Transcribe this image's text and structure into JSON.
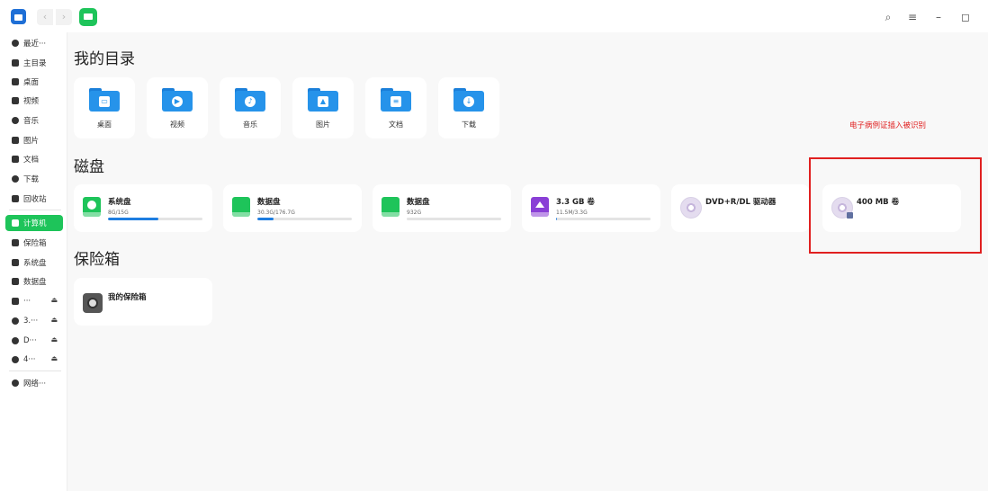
{
  "sidebar": {
    "items": [
      {
        "label": "最近···",
        "icon": "clock-icon"
      },
      {
        "label": "主目录",
        "icon": "home-icon"
      },
      {
        "label": "桌面",
        "icon": "desktop-icon"
      },
      {
        "label": "视频",
        "icon": "video-icon"
      },
      {
        "label": "音乐",
        "icon": "music-icon"
      },
      {
        "label": "图片",
        "icon": "image-icon"
      },
      {
        "label": "文档",
        "icon": "document-icon"
      },
      {
        "label": "下载",
        "icon": "download-icon"
      },
      {
        "label": "回收站",
        "icon": "trash-icon"
      },
      {
        "label": "计算机",
        "icon": "computer-icon",
        "active": true
      },
      {
        "label": "保险箱",
        "icon": "vault-icon"
      },
      {
        "label": "系统盘",
        "icon": "disk-icon"
      },
      {
        "label": "数据盘",
        "icon": "disk-icon"
      },
      {
        "label": "···",
        "icon": "disk-icon",
        "eject": "⏏"
      },
      {
        "label": "3.···",
        "icon": "usb-icon",
        "eject": "⏏"
      },
      {
        "label": "D···",
        "icon": "disc-icon",
        "eject": "⏏"
      },
      {
        "label": "4···",
        "icon": "disc-icon",
        "eject": "⏏"
      },
      {
        "label": "网络···",
        "icon": "network-icon"
      }
    ]
  },
  "titlebar": {
    "back": "‹",
    "forward": "›",
    "search": "⌕",
    "menu": "≡",
    "minimize": "–",
    "maximize": "◻"
  },
  "sections": {
    "directories": "我的目录",
    "disks": "磁盘",
    "vault": "保险箱"
  },
  "directories": [
    {
      "label": "桌面",
      "icon": "desktop-folder-icon",
      "glyph": "▭"
    },
    {
      "label": "视频",
      "icon": "video-folder-icon",
      "glyph": "▶"
    },
    {
      "label": "音乐",
      "icon": "music-folder-icon",
      "glyph": "♪"
    },
    {
      "label": "图片",
      "icon": "pictures-folder-icon",
      "glyph": "▲"
    },
    {
      "label": "文档",
      "icon": "documents-folder-icon",
      "glyph": "≡"
    },
    {
      "label": "下载",
      "icon": "downloads-folder-icon",
      "glyph": "↓"
    }
  ],
  "disks": [
    {
      "name": "系统盘",
      "size": "8G/15G",
      "usage": 0.53,
      "color": "#1ec45a",
      "icon": "system-disk-icon"
    },
    {
      "name": "数据盘",
      "size": "30.3G/176.7G",
      "usage": 0.17,
      "color": "#1ec45a",
      "icon": "data-disk-icon"
    },
    {
      "name": "数据盘",
      "size": "932G",
      "usage": 0,
      "color": "#1ec45a",
      "icon": "data-disk-icon"
    },
    {
      "name": "3.3 GB 卷",
      "size": "11.5M/3.3G",
      "usage": 0.01,
      "color": "#8a3fd6",
      "icon": "usb-disk-icon"
    },
    {
      "name": "DVD+R/DL 驱动器",
      "icon": "dvd-drive-icon"
    },
    {
      "name": "400 MB 卷",
      "icon": "disc-volume-icon"
    }
  ],
  "vault": {
    "name": "我的保险箱",
    "icon": "vault-icon"
  },
  "annotation": {
    "text": "电子病例证插入被识别",
    "color": "#e02020"
  },
  "colors": {
    "accent": "#1ec45a",
    "progress": "#1e7de0",
    "folder": "#2693ea"
  }
}
